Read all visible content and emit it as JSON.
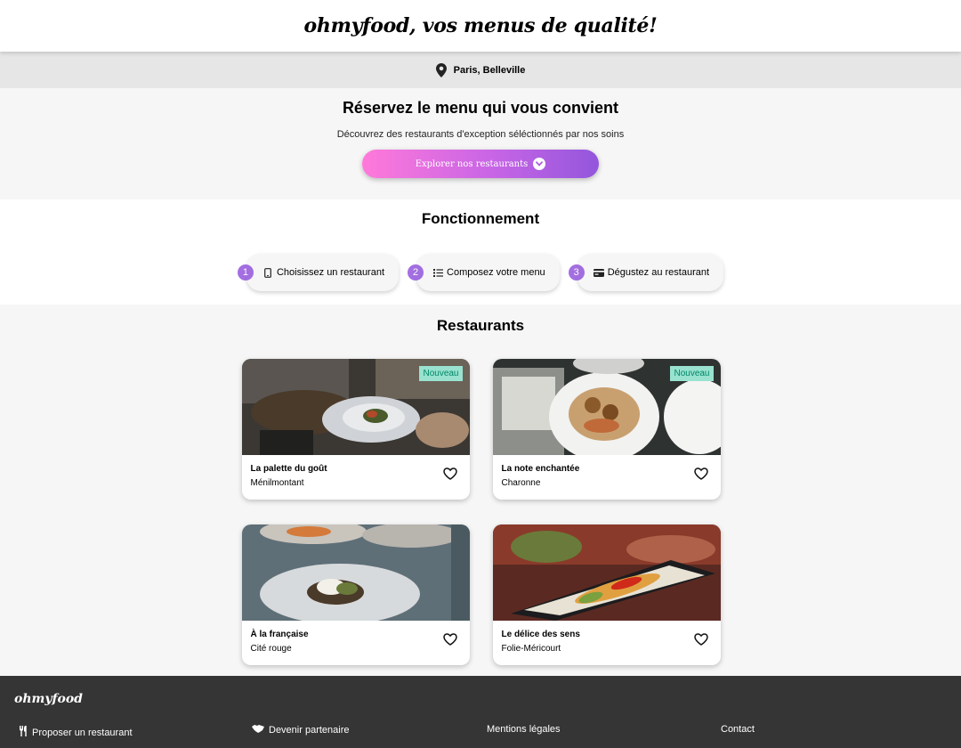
{
  "header": {
    "logo": "ohmyfood, vos menus de qualité!"
  },
  "location": {
    "icon": "map-pin-icon",
    "label": "Paris, Belleville"
  },
  "hero": {
    "title": "Réservez le menu qui vous convient",
    "subtitle": "Découvrez des restaurants d'exception séléctionnés par nos soins",
    "cta_label": "Explorer nos restaurants"
  },
  "how": {
    "title": "Fonctionnement",
    "steps": [
      {
        "num": "1",
        "icon": "phone-icon",
        "label": "Choisissez un restaurant"
      },
      {
        "num": "2",
        "icon": "list-icon",
        "label": "Composez votre menu"
      },
      {
        "num": "3",
        "icon": "card-icon",
        "label": "Dégustez au restaurant"
      }
    ]
  },
  "restaurants": {
    "title": "Restaurants",
    "cards": [
      {
        "name": "La palette du goût",
        "area": "Ménilmontant",
        "badge": "Nouveau"
      },
      {
        "name": "La note enchantée",
        "area": "Charonne",
        "badge": "Nouveau"
      },
      {
        "name": "À la française",
        "area": "Cité rouge",
        "badge": ""
      },
      {
        "name": "Le délice des sens",
        "area": "Folie-Méricourt",
        "badge": ""
      }
    ]
  },
  "footer": {
    "logo": "ohmyfood",
    "links": [
      {
        "icon": "utensils-icon",
        "label": "Proposer un restaurant"
      },
      {
        "icon": "handshake-icon",
        "label": "Devenir partenaire"
      },
      {
        "icon": "",
        "label": "Mentions légales"
      },
      {
        "icon": "",
        "label": "Contact"
      }
    ]
  },
  "colors": {
    "accent_purple": "#9356dc",
    "accent_pink": "#ff79da",
    "badge_bg": "#99e2d0",
    "badge_text": "#008766",
    "footer_bg": "#353535"
  }
}
